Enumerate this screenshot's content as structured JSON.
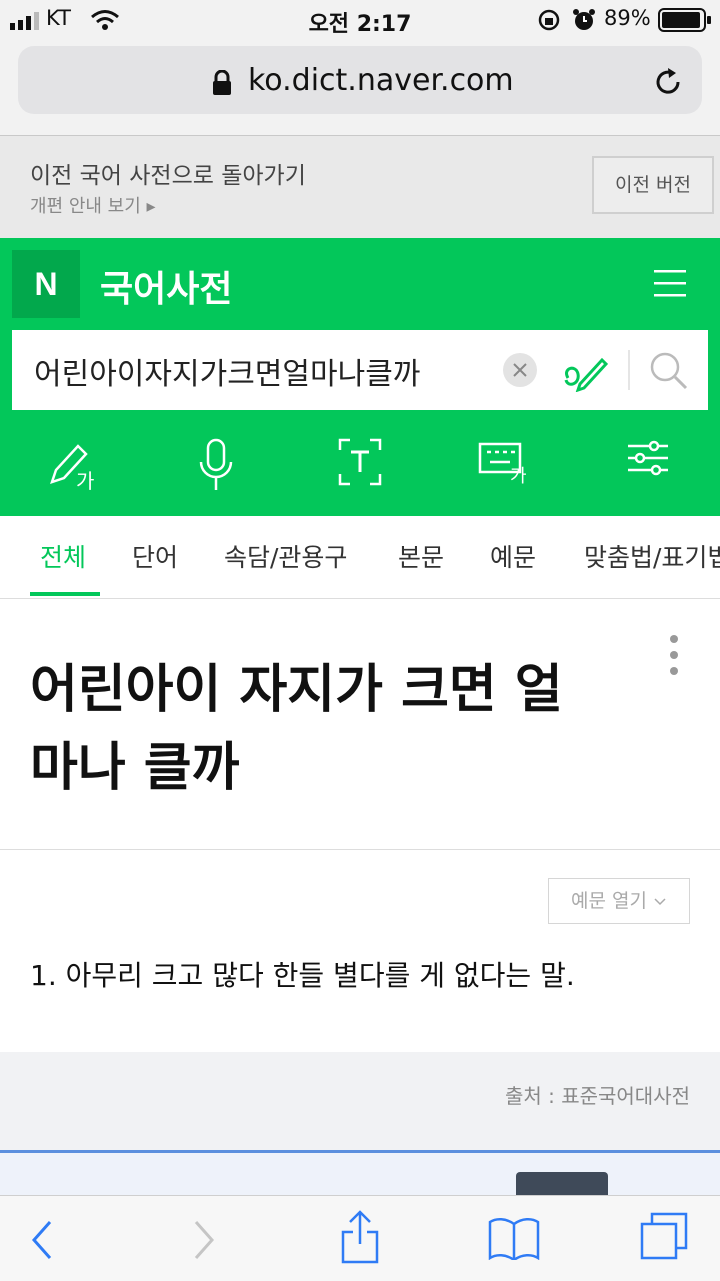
{
  "status_bar": {
    "carrier": "KT",
    "time": "오전 2:17",
    "battery": "89%"
  },
  "browser": {
    "url": "ko.dict.naver.com"
  },
  "notice": {
    "title": "이전 국어 사전으로 돌아가기",
    "subtitle": "개편 안내 보기 ▸",
    "prev_version_button": "이전 버전"
  },
  "header": {
    "logo": "N",
    "title": "국어사전"
  },
  "search": {
    "query": "어린아이자지가크면얼마나클까"
  },
  "tabs": [
    "전체",
    "단어",
    "속담/관용구",
    "본문",
    "예문",
    "맞춤법/표기법"
  ],
  "entry": {
    "title": "어린아이 자지가 크면 얼마나 클까"
  },
  "meaning": {
    "examples_toggle": "예문 열기",
    "definition": "1. 아무리 크고 많다 한들 별다를 게 없다는 말."
  },
  "source": "출처 : 표준국어대사전",
  "colors": {
    "brand_green": "#03c75a",
    "ios_blue": "#2f7bf5"
  },
  "icons": [
    "signal-icon",
    "wifi-icon",
    "lock-icon",
    "alarm-icon",
    "battery-icon",
    "reload-icon",
    "menu-icon",
    "clear-icon",
    "handwriting-icon",
    "mic-icon",
    "text-scan-icon",
    "keyboard-icon",
    "settings-sliders-icon",
    "more-icon",
    "chevron-down-icon",
    "back-icon",
    "forward-icon",
    "share-icon",
    "bookmarks-icon",
    "tabs-icon"
  ]
}
